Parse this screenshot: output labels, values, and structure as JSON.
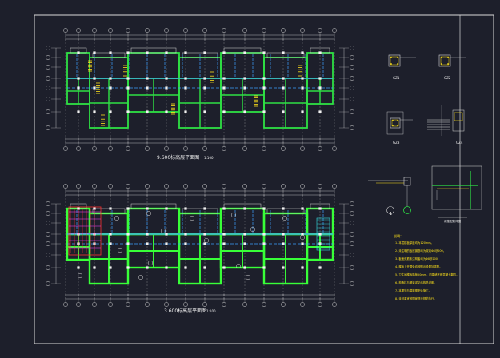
{
  "drawing": {
    "colors": {
      "background": "#1d1f2b",
      "frame": "#d9d9d9",
      "wall": "#2ee044",
      "wall_bright": "#38ff38",
      "beam": "#3da0ff",
      "column": "#f2f2f2",
      "text": "#f2f2f2",
      "note": "#ffe21a",
      "red": "#ff3030",
      "cyan": "#36e6e6",
      "magenta": "#ff40ff"
    },
    "plans": [
      {
        "id": "upper-plan",
        "title": "9.600标高层平面图",
        "scale": "1:100"
      },
      {
        "id": "lower-plan",
        "title": "3.600标高层平面图",
        "scale": "1:100"
      }
    ],
    "details": [
      {
        "id": "detail-1",
        "label": "GZ1"
      },
      {
        "id": "detail-2",
        "label": "GZ2"
      },
      {
        "id": "detail-3",
        "label": "GZ3"
      },
      {
        "id": "detail-4",
        "label": "GZ4"
      }
    ],
    "section": {
      "label": "1",
      "caption": "雨篷配筋详图"
    },
    "notes": {
      "heading": "说明：",
      "items": [
        "1. 本层楼板厚度均为120mm。",
        "2. 未注明的板底钢筋均为双向Φ8@200。",
        "3. 板面负筋未注明者均为Φ8@200。",
        "4. 楼板上开洞处均按图示设置加强筋。",
        "5. 卫生间楼板降板50mm，四周墙下做混凝土翻边。",
        "6. 构造柱与圈梁详见结构总说明。",
        "7. 本图须与建筑图配合施工。",
        "8. 未尽事宜按国家现行规范执行。"
      ]
    }
  }
}
